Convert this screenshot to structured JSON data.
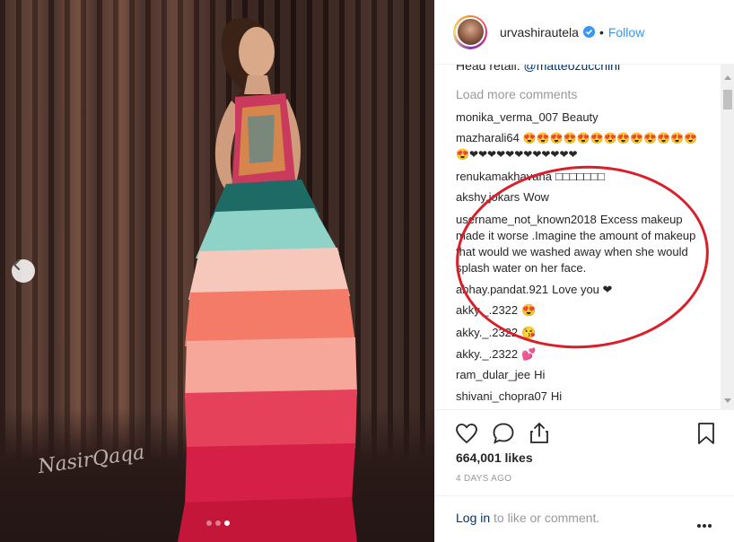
{
  "photo": {
    "watermark": "NasirQaqa",
    "carousel": {
      "dots": 3,
      "active_index": 2
    }
  },
  "header": {
    "username": "urvashirautela",
    "separator": "•",
    "follow_label": "Follow"
  },
  "comments": {
    "partial_line_prefix": "Head retail: ",
    "partial_line_mention": "@matteozucchini",
    "load_more_label": "Load more comments",
    "items": [
      {
        "user": "monika_verma_007",
        "text": "Beauty"
      },
      {
        "user": "mazharali64",
        "text": "😍😍😍😍😍😍😍😍😍😍😍😍😍 😍❤❤❤❤❤❤❤❤❤❤❤❤"
      },
      {
        "user": "renukamakhavana",
        "text": "□□□□□□□"
      },
      {
        "user": "akshy.jokars",
        "text": "Wow"
      },
      {
        "user": "username_not_known2018",
        "text": "Excess makeup made it worse .Imagine the amount of makeup that would we washed away when she would splash water on her face."
      },
      {
        "user": "abhay.pandat.921",
        "text": "Love you ❤"
      },
      {
        "user": "akky._.2322",
        "text": "😍"
      },
      {
        "user": "akky._.2322",
        "text": "😘"
      },
      {
        "user": "akky._.2322",
        "text": "💕"
      },
      {
        "user": "ram_dular_jee",
        "text": "Hi"
      },
      {
        "user": "shivani_chopra07",
        "text": "Hi"
      }
    ]
  },
  "actions": {
    "icons": [
      "heart-icon",
      "comment-icon",
      "share-icon",
      "bookmark-icon"
    ]
  },
  "likes_label": "664,001 likes",
  "date_label": "4 DAYS AGO",
  "login": {
    "link_label": "Log in",
    "suffix": " to like or comment."
  },
  "colors": {
    "link_blue": "#3897f0",
    "annotation_red": "#d9202a",
    "muted_gray": "#999999"
  }
}
